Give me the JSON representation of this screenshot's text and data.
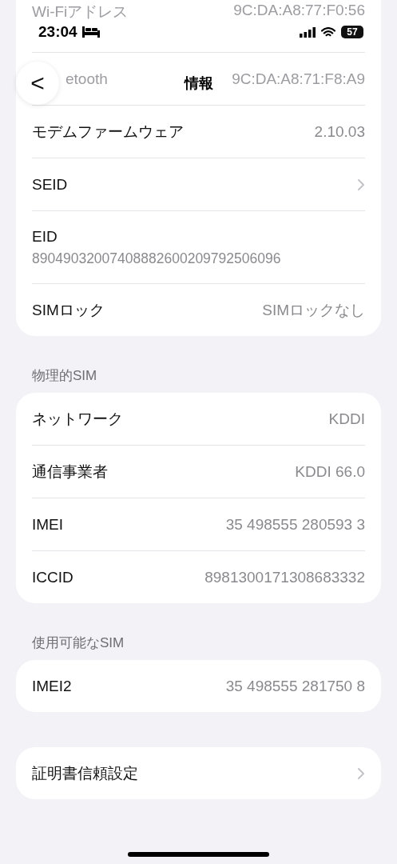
{
  "status_bar": {
    "time": "23:04",
    "battery": "57"
  },
  "nav": {
    "title": "情報",
    "back": "<"
  },
  "under_header_rows": [
    {
      "label": "Wi-Fiアドレス",
      "value": "9C:DA:A8:77:F0:56"
    },
    {
      "label": "etooth",
      "value": "9C:DA:A8:71:F8:A9"
    }
  ],
  "sections": [
    {
      "rows": [
        {
          "kind": "value",
          "label": "モデムファームウェア",
          "value": "2.10.03"
        },
        {
          "kind": "chevron",
          "label": "SEID"
        },
        {
          "kind": "stacked",
          "label": "EID",
          "value": "89049032007408882600209792506096"
        },
        {
          "kind": "value",
          "label": "SIMロック",
          "value": "SIMロックなし"
        }
      ]
    },
    {
      "header": "物理的SIM",
      "rows": [
        {
          "kind": "value",
          "label": "ネットワーク",
          "value": "KDDI"
        },
        {
          "kind": "value",
          "label": "通信事業者",
          "value": "KDDI 66.0"
        },
        {
          "kind": "value",
          "label": "IMEI",
          "value": "35 498555 280593 3"
        },
        {
          "kind": "value",
          "label": "ICCID",
          "value": "8981300171308683332"
        }
      ]
    },
    {
      "header": "使用可能なSIM",
      "rows": [
        {
          "kind": "value",
          "label": "IMEI2",
          "value": "35 498555 281750 8"
        }
      ]
    },
    {
      "rows": [
        {
          "kind": "chevron",
          "label": "証明書信頼設定"
        }
      ]
    }
  ]
}
